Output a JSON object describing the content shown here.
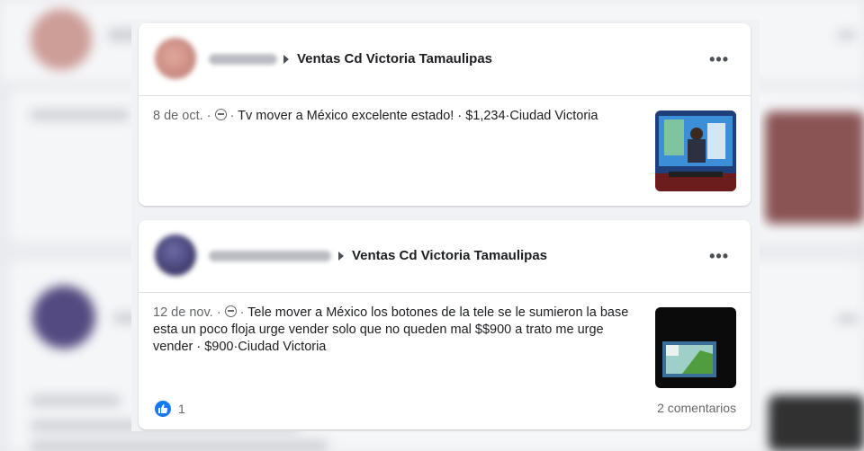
{
  "posts": [
    {
      "group": "Ventas Cd Victoria Tamaulipas",
      "date": "8 de oct.",
      "text": "Tv mover a México excelente estado! · $1,234·Ciudad Victoria",
      "more_label": "•••"
    },
    {
      "group": "Ventas Cd Victoria Tamaulipas",
      "date": "12 de nov.",
      "text": "Tele mover a México los botones de la tele se le sumieron la base esta un poco floja urge vender solo que no queden mal $$900 a trato me urge vender · $900·Ciudad Victoria",
      "more_label": "•••",
      "likes": "1",
      "comments": "2 comentarios"
    }
  ],
  "colors": {
    "accent": "#1877f2",
    "page_bg": "#f0f2f5",
    "secondary_text": "#65676b"
  },
  "icons": [
    "globe-icon",
    "chevron-right-icon",
    "more-icon",
    "like-icon"
  ]
}
